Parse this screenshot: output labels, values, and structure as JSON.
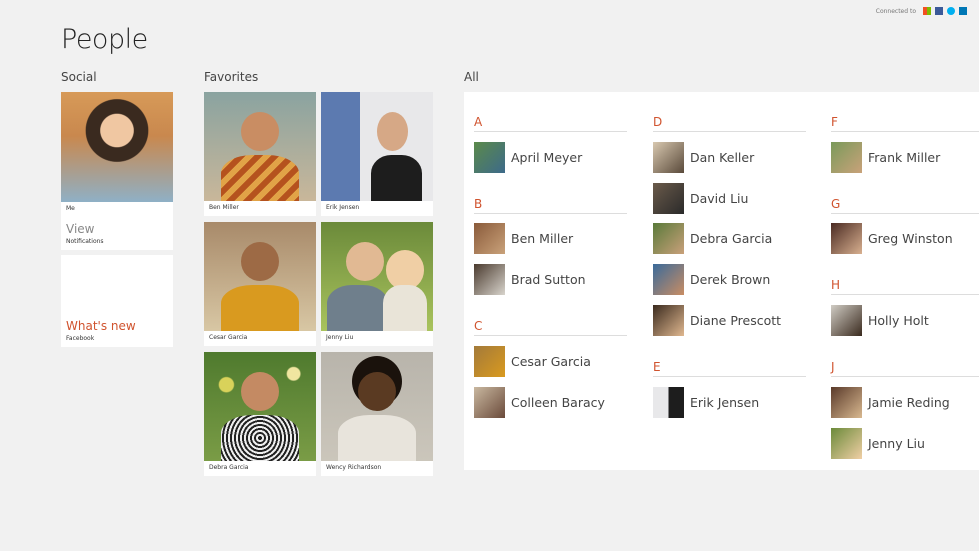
{
  "header": {
    "title": "People",
    "connected_label": "Connected to",
    "services": [
      {
        "icon": "microsoft-icon",
        "color": "#f25022"
      },
      {
        "icon": "facebook-icon",
        "color": "#3b5998"
      },
      {
        "icon": "skype-icon",
        "color": "#00aff0"
      },
      {
        "icon": "linkedin-icon",
        "color": "#0077b5"
      }
    ]
  },
  "social": {
    "heading": "Social",
    "me_label": "Me",
    "view_label": "View",
    "notifications_label": "Notifications",
    "whats_new_label": "What's new",
    "facebook_label": "Facebook"
  },
  "favorites": {
    "heading": "Favorites",
    "items": [
      {
        "name": "Ben Miller"
      },
      {
        "name": "Erik Jensen"
      },
      {
        "name": "Cesar Garcia"
      },
      {
        "name": "Jenny Liu"
      },
      {
        "name": "Debra Garcia"
      },
      {
        "name": "Wency Richardson"
      }
    ]
  },
  "all": {
    "heading": "All",
    "groups": [
      {
        "letter": "A",
        "contacts": [
          "April Meyer"
        ]
      },
      {
        "letter": "B",
        "contacts": [
          "Ben Miller",
          "Brad Sutton"
        ]
      },
      {
        "letter": "C",
        "contacts": [
          "Cesar Garcia",
          "Colleen Baracy"
        ]
      },
      {
        "letter": "D",
        "contacts": [
          "Dan Keller",
          "David Liu",
          "Debra Garcia",
          "Derek Brown",
          "Diane Prescott"
        ]
      },
      {
        "letter": "E",
        "contacts": [
          "Erik Jensen"
        ]
      },
      {
        "letter": "F",
        "contacts": [
          "Frank Miller"
        ]
      },
      {
        "letter": "G",
        "contacts": [
          "Greg Winston"
        ]
      },
      {
        "letter": "H",
        "contacts": [
          "Holly Holt"
        ]
      },
      {
        "letter": "J",
        "contacts": [
          "Jamie Reding",
          "Jenny Liu"
        ]
      }
    ]
  },
  "colors": {
    "accent": "#d0532e",
    "background": "#f1f1f1",
    "panel": "#ffffff"
  }
}
